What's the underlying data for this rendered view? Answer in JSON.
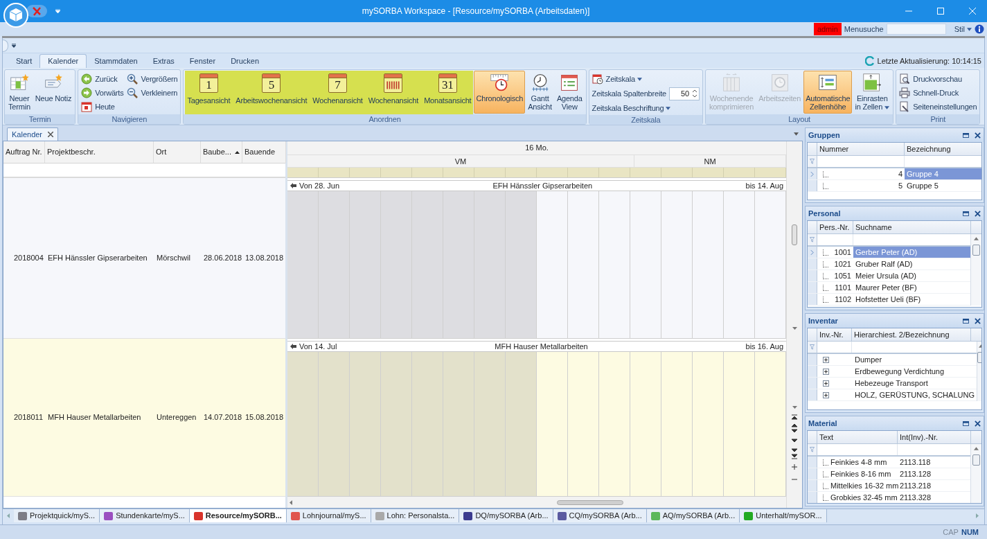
{
  "window": {
    "title": "mySORBA Workspace - [Resource/mySORBA (Arbeitsdaten)]"
  },
  "top_bar": {
    "user": "admin",
    "search_label": "Menusuche",
    "style_label": "Stil"
  },
  "ribbon_tabs": [
    {
      "label": "Start",
      "selected": false
    },
    {
      "label": "Kalender",
      "selected": true
    },
    {
      "label": "Stammdaten",
      "selected": false
    },
    {
      "label": "Extras",
      "selected": false
    },
    {
      "label": "Fenster",
      "selected": false
    },
    {
      "label": "Drucken",
      "selected": false
    }
  ],
  "last_update": "Letzte Aktualisierung: 10:14:15",
  "ribbon_groups": [
    {
      "title": "Termin",
      "columns": [
        [
          {
            "kind": "large",
            "lines": [
              "Neuer",
              "Termin"
            ],
            "selected": false,
            "disabled": false
          }
        ],
        [
          {
            "kind": "large",
            "lines": [
              "Neue Notiz"
            ],
            "selected": false,
            "disabled": false
          }
        ]
      ]
    },
    {
      "title": "Navigieren",
      "columns": [
        [
          {
            "kind": "small",
            "label": "Zurück"
          },
          {
            "kind": "small",
            "label": "Vorwärts"
          },
          {
            "kind": "small",
            "label": "Heute"
          }
        ],
        [
          {
            "kind": "small",
            "label": "Vergrößern"
          },
          {
            "kind": "small",
            "label": "Verkleinern"
          }
        ]
      ]
    },
    {
      "title": "Anordnen",
      "highlighted": true,
      "columns": [
        [
          {
            "kind": "calendar",
            "number": "1",
            "lines": [
              "Tagesansicht"
            ],
            "selected": false,
            "disabled": false
          }
        ],
        [
          {
            "kind": "calendar",
            "number": "5",
            "lines": [
              "Arbeitswochenansicht"
            ],
            "selected": false,
            "disabled": false
          }
        ],
        [
          {
            "kind": "calendar",
            "number": "7",
            "lines": [
              "Wochenansicht"
            ],
            "selected": false,
            "disabled": false
          }
        ],
        [
          {
            "kind": "calendar-bars",
            "lines": [
              "Wochenansicht"
            ],
            "selected": false,
            "disabled": false
          }
        ],
        [
          {
            "kind": "calendar",
            "number": "31",
            "lines": [
              "Monatsansicht"
            ],
            "selected": false,
            "disabled": false
          }
        ],
        [
          {
            "kind": "large",
            "lines": [
              "Chronologisch"
            ],
            "selected": true,
            "disabled": false
          }
        ],
        [
          {
            "kind": "large",
            "lines": [
              "Gantt",
              "Ansicht"
            ],
            "selected": false,
            "disabled": false
          }
        ],
        [
          {
            "kind": "large",
            "lines": [
              "Agenda",
              "View"
            ],
            "selected": false,
            "disabled": false
          }
        ]
      ]
    },
    {
      "title": "Zeitskala",
      "columns": [
        [
          {
            "kind": "small",
            "label": "Zeitskala",
            "dropdown": true
          },
          {
            "kind": "spin",
            "label": "Zeitskala Spaltenbreite",
            "value": "50"
          },
          {
            "kind": "small",
            "label": "Zeitskala Beschriftung",
            "dropdown": true
          }
        ]
      ]
    },
    {
      "title": "Layout",
      "columns": [
        [
          {
            "kind": "large",
            "lines": [
              "Wochenende",
              "komprimieren"
            ],
            "selected": false,
            "disabled": true
          }
        ],
        [
          {
            "kind": "large",
            "lines": [
              "Arbeitszeiten"
            ],
            "selected": false,
            "disabled": true
          }
        ],
        [
          {
            "kind": "large",
            "lines": [
              "Automatische",
              "Zellenhöhe"
            ],
            "selected": true,
            "disabled": false
          }
        ],
        [
          {
            "kind": "large",
            "lines": [
              "Einrasten",
              "in Zellen"
            ],
            "selected": false,
            "disabled": false,
            "dropdown": true
          }
        ]
      ]
    },
    {
      "title": "Print",
      "columns": [
        [
          {
            "kind": "small",
            "label": "Druckvorschau"
          },
          {
            "kind": "small",
            "label": "Schnell-Druck"
          },
          {
            "kind": "small",
            "label": "Seiteneinstellungen"
          }
        ]
      ]
    }
  ],
  "document_tab": {
    "label": "Kalender"
  },
  "grid": {
    "columns": [
      {
        "label": "Auftrag Nr.",
        "sorted": false
      },
      {
        "label": "Projektbeschr.",
        "sorted": false
      },
      {
        "label": "Ort",
        "sorted": false
      },
      {
        "label": "Baube...",
        "sorted": true
      },
      {
        "label": "Bauende",
        "sorted": false
      }
    ],
    "rows": [
      {
        "cells": [
          "2018004",
          "EFH Hänssler Gipserarbeiten",
          "Mörschwil",
          "28.06.2018",
          "13.08.2018"
        ],
        "color": "#f6f7fb",
        "from": "Von 28. Jun",
        "title": "EFH Hänssler Gipserarbeiten",
        "to": "bis 14. Aug"
      },
      {
        "cells": [
          "2018011",
          "MFH Hauser Metallarbeiten",
          "Untereggen",
          "14.07.2018",
          "15.08.2018"
        ],
        "color": "#fdfbe2",
        "from": "Von 14. Jul",
        "title": "MFH Hauser Metallarbeiten",
        "to": "bis 16. Aug"
      }
    ]
  },
  "timeline": {
    "day": "16 Mo.",
    "periods": [
      "VM",
      "NM"
    ],
    "slots": [
      {
        "shaded": true
      },
      {
        "shaded": true
      },
      {
        "shaded": true
      },
      {
        "shaded": true
      },
      {
        "shaded": true
      },
      {
        "shaded": true
      },
      {
        "shaded": true
      },
      {
        "shaded": true
      },
      {
        "shaded": false
      },
      {
        "shaded": false
      },
      {
        "shaded": false
      },
      {
        "shaded": false
      },
      {
        "shaded": false
      },
      {
        "shaded": false
      },
      {
        "shaded": false
      },
      {
        "shaded": false
      }
    ]
  },
  "panels": [
    {
      "title": "Gruppen",
      "kind": "id",
      "columns": [
        "Nummer",
        "Bezeichnung"
      ],
      "rows": [
        {
          "first": "4",
          "second": "Gruppe 4",
          "selected": true
        },
        {
          "first": "5",
          "second": "Gruppe 5",
          "selected": false
        }
      ]
    },
    {
      "title": "Personal",
      "kind": "id",
      "scrollable": true,
      "columns": [
        "Pers.-Nr.",
        "Suchname"
      ],
      "rows": [
        {
          "first": "1001",
          "second": "Gerber Peter (AD)",
          "selected": true
        },
        {
          "first": "1021",
          "second": "Gruber Ralf (AD)",
          "selected": false
        },
        {
          "first": "1051",
          "second": "Meier Ursula (AD)",
          "selected": false
        },
        {
          "first": "1101",
          "second": "Maurer Peter (BF)",
          "selected": false
        },
        {
          "first": "1102",
          "second": "Hofstetter Ueli (BF)",
          "selected": false
        }
      ]
    },
    {
      "title": "Inventar",
      "kind": "tree",
      "scrollable": true,
      "columns": [
        "Inv.-Nr.",
        "Hierarchiest. 2/Bezeichnung"
      ],
      "rows": [
        {
          "second": "Dumper",
          "selected": false
        },
        {
          "second": "Erdbewegung Verdichtung",
          "selected": false
        },
        {
          "second": "Hebezeuge Transport",
          "selected": false
        },
        {
          "second": "HOLZ, GERÜSTUNG, SCHALUNG",
          "selected": false
        }
      ]
    },
    {
      "title": "Material",
      "kind": "text",
      "scrollable": true,
      "columns": [
        "Text",
        "Int(Inv).-Nr."
      ],
      "rows": [
        {
          "first": "Feinkies 4-8 mm",
          "second": "2113.118",
          "selected": false
        },
        {
          "first": "Feinkies 8-16 mm",
          "second": "2113.128",
          "selected": false
        },
        {
          "first": "Mittelkies 16-32 mm",
          "second": "2113.218",
          "selected": false
        },
        {
          "first": "Grobkies 32-45 mm",
          "second": "2113.328",
          "selected": false
        }
      ]
    }
  ],
  "doc_tabs": [
    {
      "label": "Projektquick/myS...",
      "selected": false,
      "color": "#7d7d86"
    },
    {
      "label": "Stundenkarte/myS...",
      "selected": false,
      "color": "#9b4fc0"
    },
    {
      "label": "Resource/mySORB...",
      "selected": true,
      "color": "#d9342b"
    },
    {
      "label": "Lohnjournal/myS...",
      "selected": false,
      "color": "#e0564f"
    },
    {
      "label": "Lohn: Personalsta...",
      "selected": false,
      "color": "#a9a9a9"
    },
    {
      "label": "DQ/mySORBA (Arb...",
      "selected": false,
      "color": "#3b3b8f"
    },
    {
      "label": "CQ/mySORBA (Arb...",
      "selected": false,
      "color": "#5a5aa0"
    },
    {
      "label": "AQ/mySORBA (Arb...",
      "selected": false,
      "color": "#5cb85c"
    },
    {
      "label": "Unterhalt/mySOR...",
      "selected": false,
      "color": "#22aa22"
    }
  ],
  "status": [
    {
      "label": "CAP",
      "on": false
    },
    {
      "label": "NUM",
      "on": true
    }
  ]
}
